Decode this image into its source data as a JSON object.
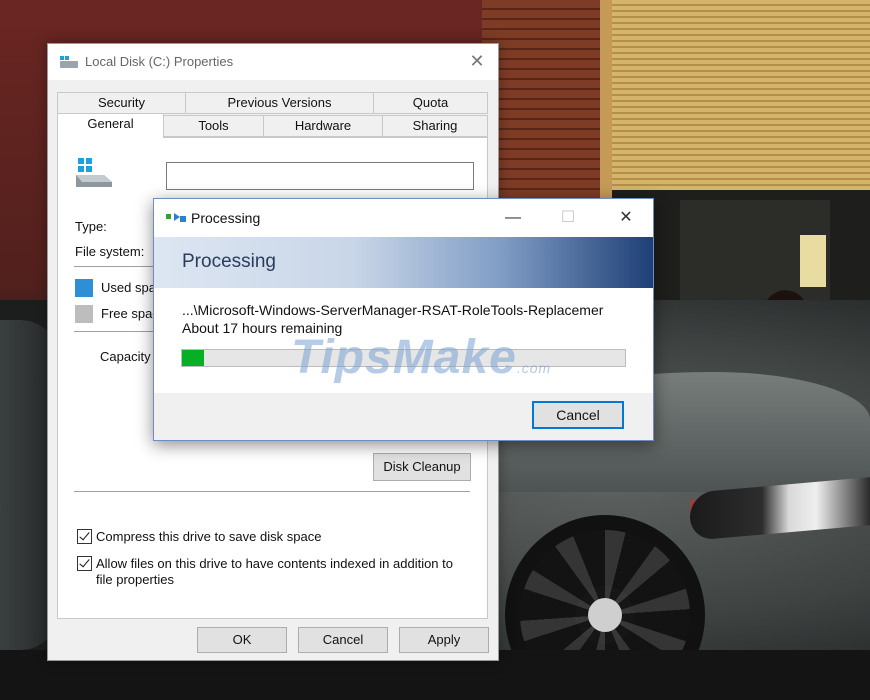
{
  "properties": {
    "title": "Local Disk (C:) Properties",
    "close_glyph": "✕",
    "tabs_row1": [
      "Security",
      "Previous Versions",
      "Quota"
    ],
    "tabs_row2": [
      "General",
      "Tools",
      "Hardware",
      "Sharing"
    ],
    "active_tab": "General",
    "name_value": "",
    "type_label": "Type:",
    "filesystem_label": "File system:",
    "used_label": "Used spa",
    "free_label": "Free spac",
    "capacity_label": "Capacity",
    "used_color": "#2f8fd6",
    "free_color": "#bdbdbd",
    "disk_cleanup": "Disk Cleanup",
    "compress_label": "Compress this drive to save disk space",
    "compress_checked": true,
    "index_label_1": "Allow files on this drive to have contents indexed in addition to",
    "index_label_2": "file properties",
    "index_checked": true,
    "ok": "OK",
    "cancel": "Cancel",
    "apply": "Apply"
  },
  "processing": {
    "title": "Processing",
    "minimize_glyph": "—",
    "maximize_glyph": "☐",
    "close_glyph": "✕",
    "banner": "Processing",
    "path": "...\\Microsoft-Windows-ServerManager-RSAT-RoleTools-Replacemer",
    "remaining": "About 17 hours remaining",
    "progress_percent": 5,
    "cancel": "Cancel",
    "accent_color": "#0078d7",
    "progress_color": "#06b025"
  },
  "watermark": {
    "text": "TipsMake",
    "suffix": ".com"
  }
}
